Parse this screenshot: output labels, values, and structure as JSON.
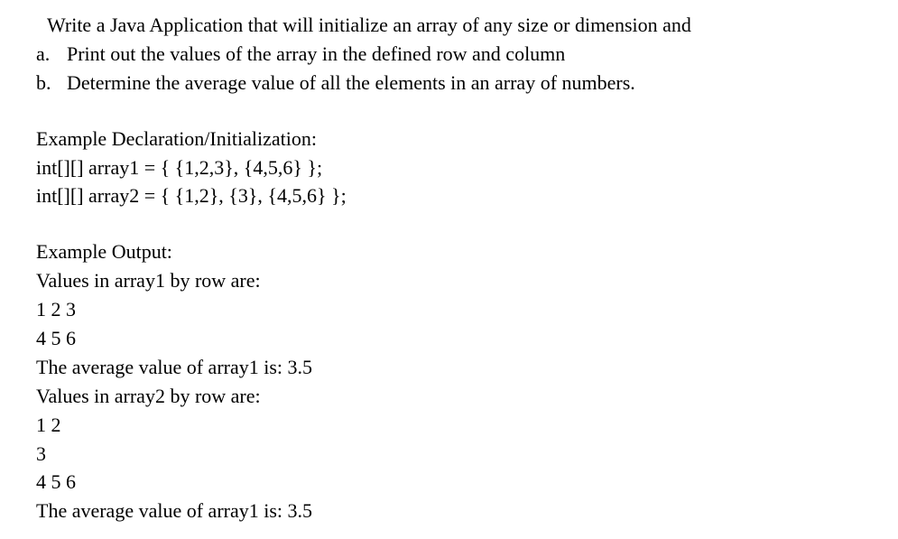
{
  "intro": "Write a Java Application that will initialize an array of any size or dimension and",
  "items": [
    {
      "marker": "a.",
      "text": "Print out the values of the array in the defined row and column"
    },
    {
      "marker": "b.",
      "text": "Determine the average value of all the elements in an array of numbers."
    }
  ],
  "declHeader": "Example Declaration/Initialization:",
  "decl1": "int[][] array1 = { {1,2,3}, {4,5,6} };",
  "decl2": "int[][] array2 = { {1,2}, {3}, {4,5,6} };",
  "outHeader": "Example Output:",
  "out1": "Values in array1 by row are:",
  "out2": "1 2 3",
  "out3": "4 5 6",
  "out4": "The average value of array1 is:  3.5",
  "out5": "Values in array2 by row are:",
  "out6": "1 2",
  "out7": "3",
  "out8": "4 5 6",
  "out9": "The average value of array1 is:  3.5"
}
